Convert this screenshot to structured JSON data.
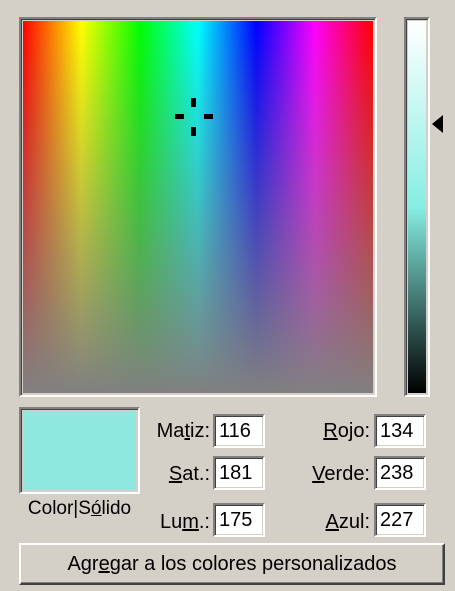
{
  "colors": {
    "dialog_bg": "#d4d0c8",
    "solid_color": "#8ee8e0"
  },
  "fields": {
    "hue": {
      "pre": "Ma",
      "ul": "t",
      "post": "iz:",
      "value": "116"
    },
    "sat": {
      "pre": "",
      "ul": "S",
      "post": "at.:",
      "value": "181"
    },
    "lum": {
      "pre": "Lu",
      "ul": "m",
      "post": ".:",
      "value": "175"
    },
    "red": {
      "pre": "",
      "ul": "R",
      "post": "ojo:",
      "value": "134"
    },
    "green": {
      "pre": "",
      "ul": "V",
      "post": "erde:",
      "value": "238"
    },
    "blue": {
      "pre": "",
      "ul": "A",
      "post": "zul:",
      "value": "227"
    }
  },
  "swatch": {
    "label_pre": "Color|S",
    "label_ul": "ó",
    "label_post": "lido"
  },
  "add_button": {
    "pre": "Agr",
    "ul": "e",
    "post": "gar a los colores personalizados"
  },
  "icons": {
    "crosshair": "crosshair-icon",
    "luminance_pointer": "triangle-left-icon"
  }
}
